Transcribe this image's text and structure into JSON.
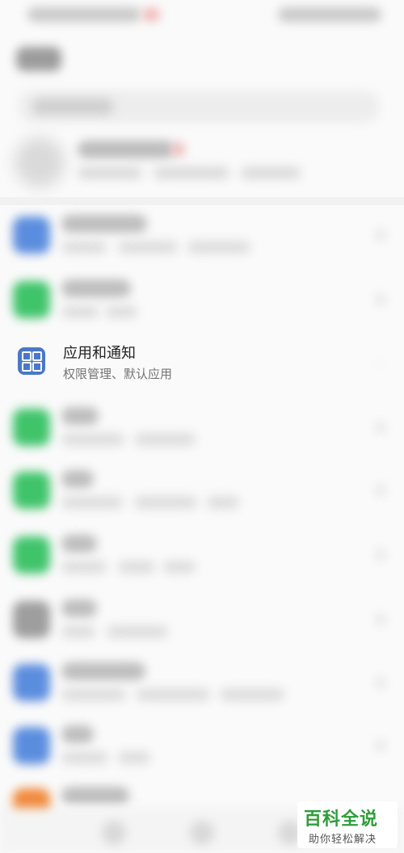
{
  "apps_row": {
    "title": "应用和通知",
    "subtitle": "权限管理、默认应用",
    "icon": "apps-grid-icon",
    "icon_color": "#4a78c8"
  },
  "blurred_rows": [
    {
      "icon": "blurred-icon",
      "color": "#5b8dde"
    },
    {
      "icon": "blurred-icon",
      "color": "#3fc46a"
    },
    {
      "icon": "blurred-icon",
      "color": "#3fc46a"
    },
    {
      "icon": "blurred-icon",
      "color": "#3fc46a"
    },
    {
      "icon": "blurred-icon",
      "color": "#3fc46a"
    },
    {
      "icon": "blurred-icon",
      "color": "#9e9e9e"
    },
    {
      "icon": "blurred-icon",
      "color": "#5b8dde"
    },
    {
      "icon": "blurred-icon",
      "color": "#5b8dde"
    },
    {
      "icon": "blurred-icon",
      "color": "#f08a3c"
    }
  ],
  "watermark": {
    "main": "百科全说",
    "sub": "助你轻松解决",
    "color": "#2f9d3b"
  }
}
